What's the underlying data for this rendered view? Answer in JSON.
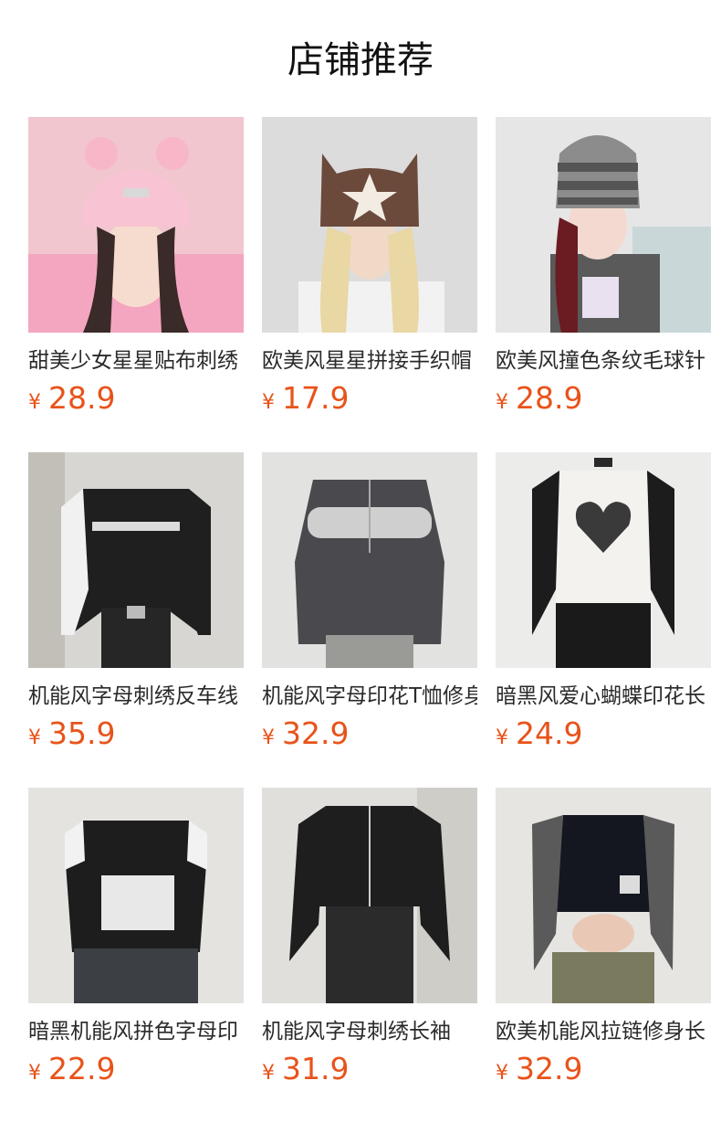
{
  "header": {
    "title": "店铺推荐"
  },
  "currency_symbol": "¥",
  "colors": {
    "price": "#e8531a",
    "title": "#2a2a2a"
  },
  "products": [
    {
      "title": "甜美少女星星贴布刺绣",
      "price": "28.9",
      "image": "pink-cat-ear-beanie"
    },
    {
      "title": "欧美风星星拼接手织帽",
      "price": "17.9",
      "image": "brown-star-cat-ear-beanie"
    },
    {
      "title": "欧美风撞色条纹毛球针",
      "price": "28.9",
      "image": "striped-knit-beanie"
    },
    {
      "title": "机能风字母刺绣反车线",
      "price": "35.9",
      "image": "black-white-zip-top"
    },
    {
      "title": "机能风字母印花T恤修身",
      "price": "32.9",
      "image": "grey-print-long-tee"
    },
    {
      "title": "暗黑风爱心蝴蝶印花长",
      "price": "24.9",
      "image": "heart-raglan-tee"
    },
    {
      "title": "暗黑机能风拼色字母印",
      "price": "22.9",
      "image": "number-72-crop-tee"
    },
    {
      "title": "机能风字母刺绣长袖",
      "price": "31.9",
      "image": "black-zip-crop-jacket"
    },
    {
      "title": "欧美机能风拉链修身长",
      "price": "32.9",
      "image": "grey-raglan-zip-top"
    }
  ]
}
